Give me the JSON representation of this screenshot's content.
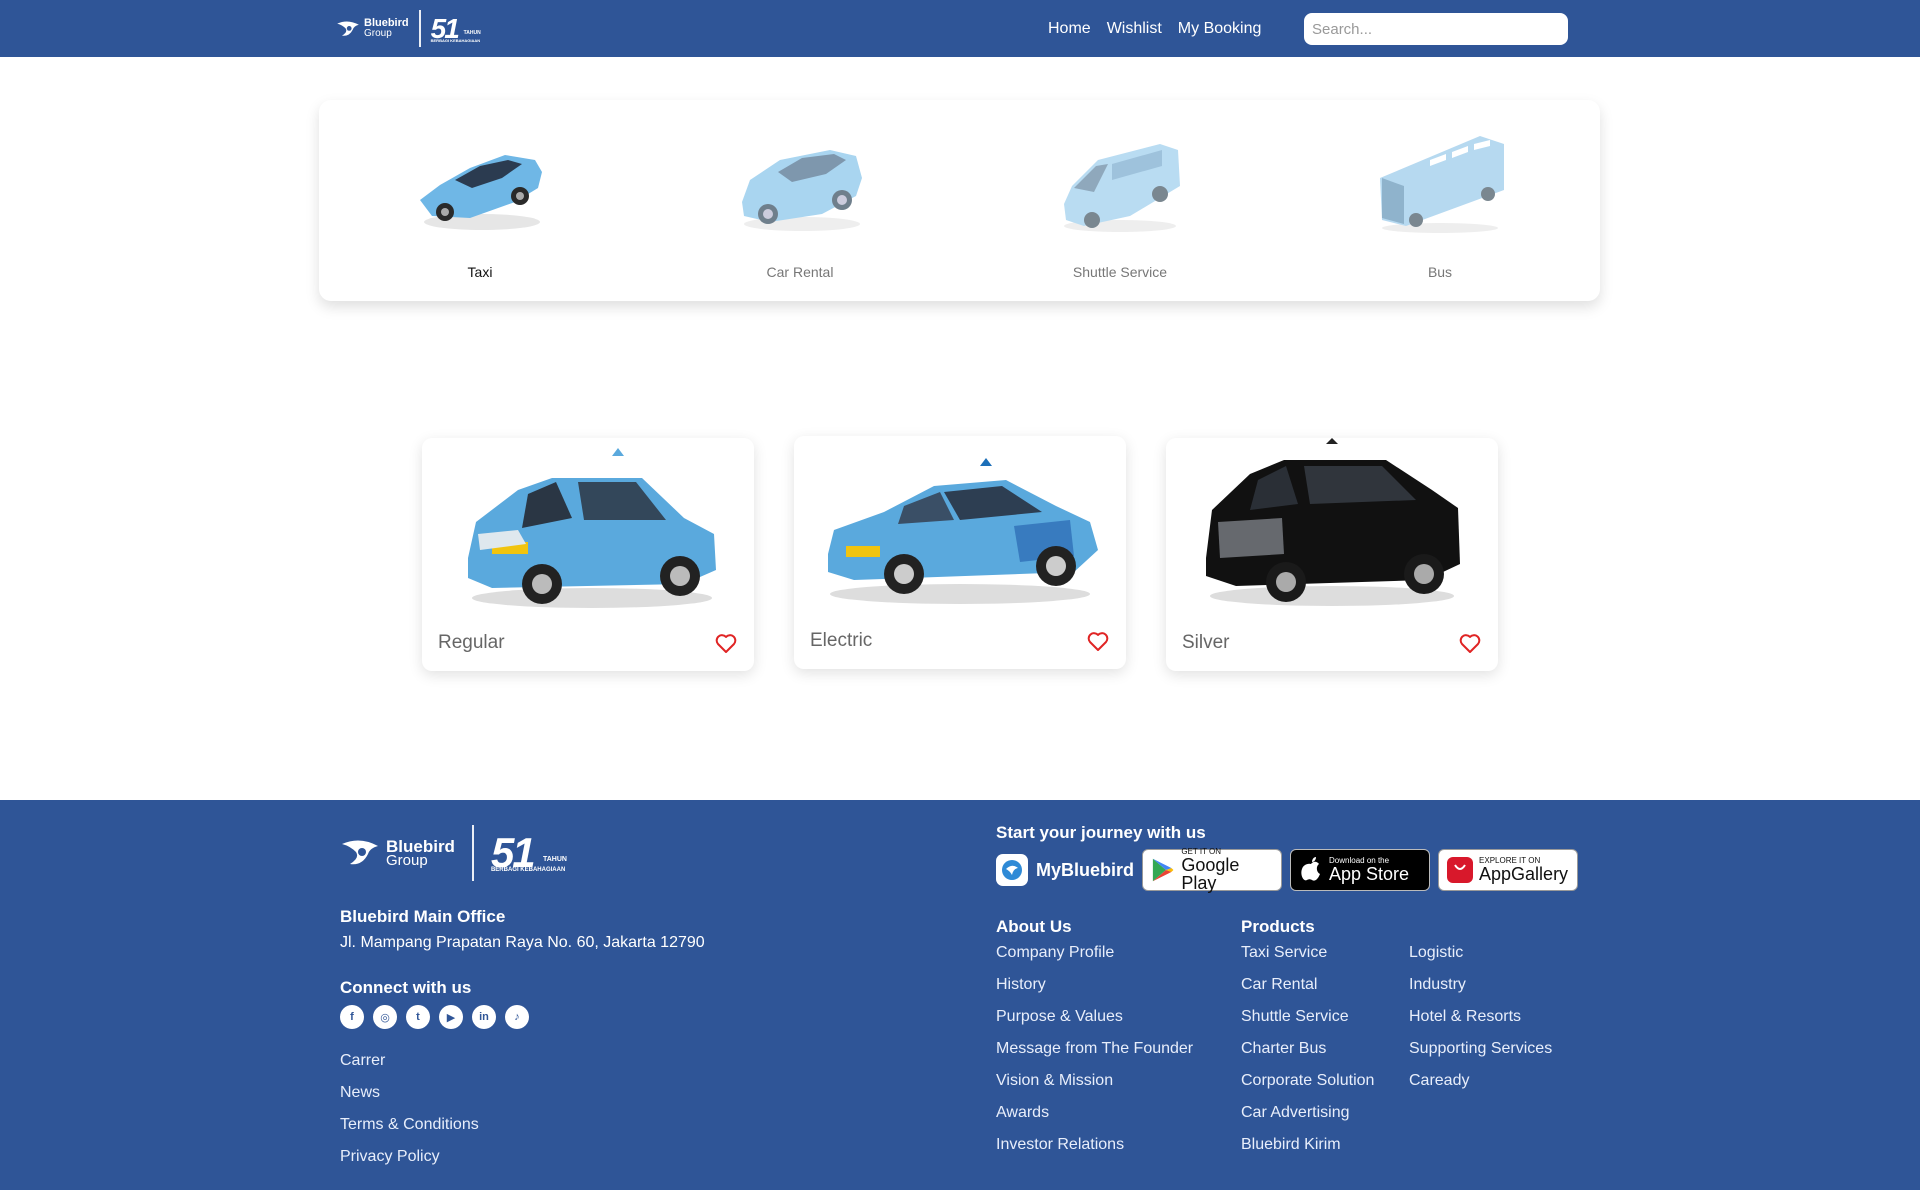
{
  "header": {
    "logo_brand": "Bluebird",
    "logo_group": "Group",
    "logo_anniv_number": "51",
    "logo_anniv_word": "TAHUN",
    "logo_anniv_tagline": "BERBAGI KEBAHAGIAAN",
    "nav": [
      {
        "label": "Home"
      },
      {
        "label": "Wishlist"
      },
      {
        "label": "My Booking"
      }
    ],
    "search_placeholder": "Search...",
    "search_value": ""
  },
  "services": [
    {
      "label": "Taxi",
      "icon": "taxi-car-icon",
      "active": true
    },
    {
      "label": "Car Rental",
      "icon": "suv-car-icon",
      "active": false
    },
    {
      "label": "Shuttle Service",
      "icon": "van-icon",
      "active": false
    },
    {
      "label": "Bus",
      "icon": "bus-icon",
      "active": false
    }
  ],
  "cars": [
    {
      "name": "Regular",
      "image": "blue-mpv-taxi",
      "color": "#5aa9dd",
      "wishlist": false
    },
    {
      "name": "Electric",
      "image": "blue-electric-sedan-taxi",
      "color": "#5aa9dd",
      "wishlist": false
    },
    {
      "name": "Silver",
      "image": "black-luxury-van",
      "color": "#111111",
      "wishlist": false
    }
  ],
  "footer": {
    "office_title": "Bluebird Main Office",
    "office_address": "Jl. Mampang Prapatan Raya No. 60, Jakarta 12790",
    "connect_title": "Connect with us",
    "socials": [
      "facebook-icon",
      "instagram-icon",
      "twitter-icon",
      "youtube-icon",
      "linkedin-icon",
      "tiktok-icon"
    ],
    "misc_links": [
      "Carrer",
      "News",
      "Terms & Conditions",
      "Privacy Policy"
    ],
    "journey_title": "Start your journey with us",
    "app_name": "MyBluebird",
    "stores": [
      {
        "small": "GET IT ON",
        "big": "Google Play"
      },
      {
        "small": "Download on the",
        "big": "App Store"
      },
      {
        "small": "EXPLORE IT ON",
        "big": "AppGallery"
      }
    ],
    "about_title": "About Us",
    "about_links": [
      "Company Profile",
      "History",
      "Purpose & Values",
      "Message from The Founder",
      "Vision & Mission",
      "Awards",
      "Investor Relations"
    ],
    "products_title": "Products",
    "products_col1": [
      "Taxi Service",
      "Car Rental",
      "Shuttle Service",
      "Charter Bus",
      "Corporate Solution",
      "Car Advertising",
      "Bluebird Kirim"
    ],
    "products_col2": [
      "Logistic",
      "Industry",
      "Hotel & Resorts",
      "Supporting Services",
      "Caready"
    ]
  },
  "colors": {
    "primary": "#2f5597",
    "taxi_blue": "#5aa9dd",
    "heart_red": "#e02424"
  }
}
